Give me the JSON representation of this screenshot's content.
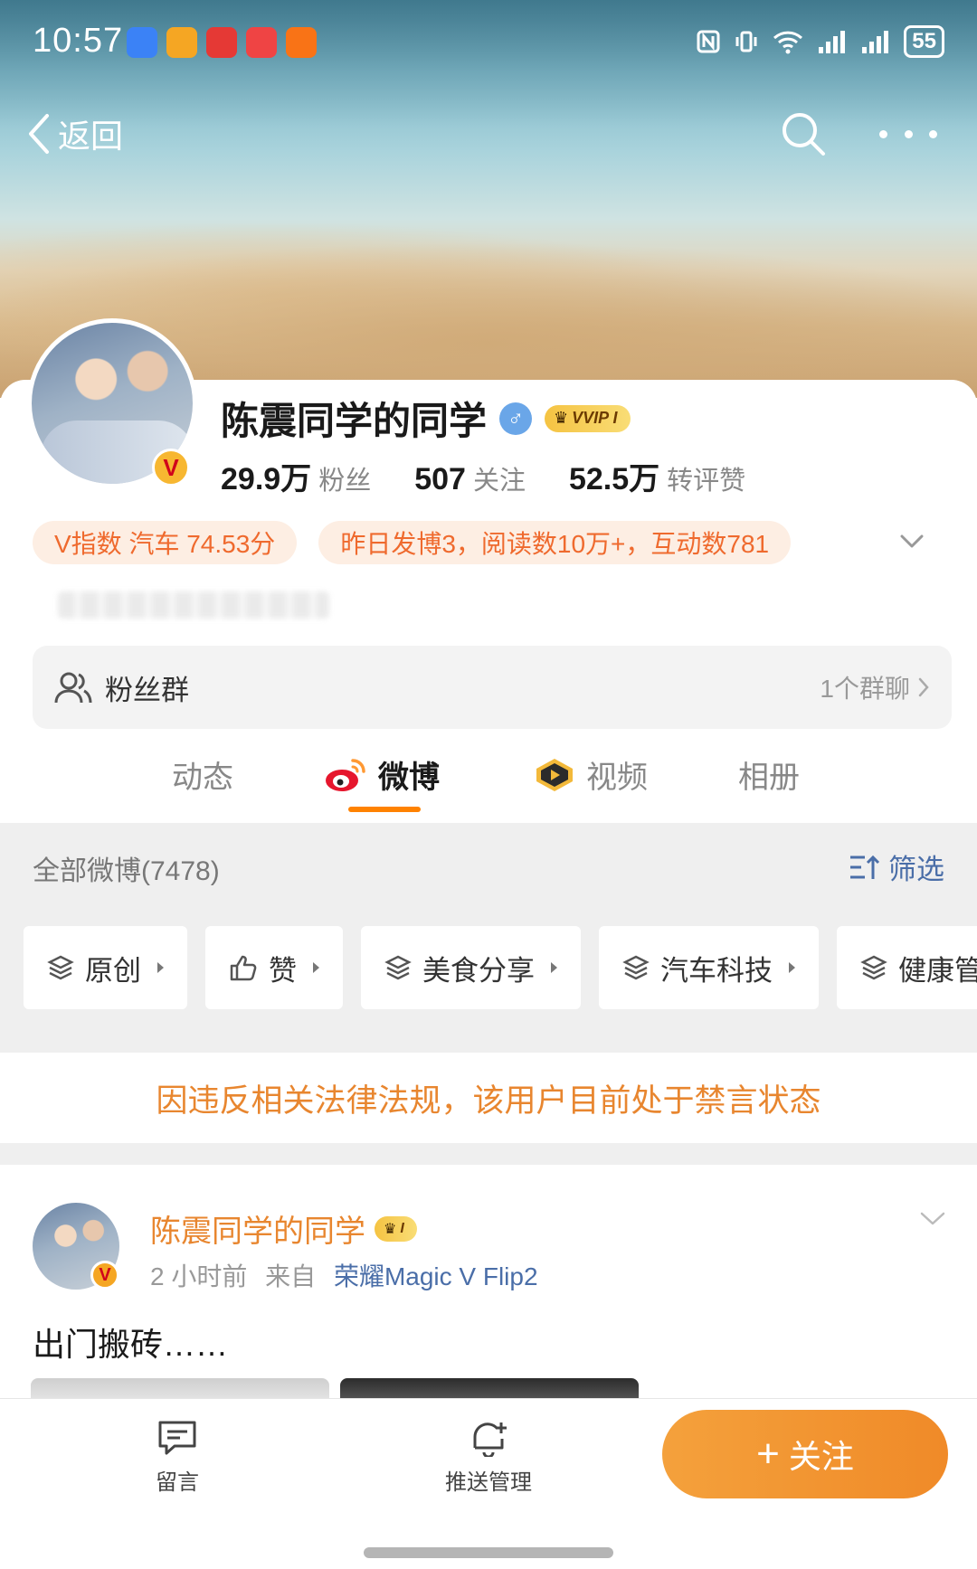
{
  "status_bar": {
    "time": "10:57",
    "battery": "55"
  },
  "nav": {
    "back_label": "返回"
  },
  "profile": {
    "name": "陈震同学的同学",
    "gender_symbol": "♂",
    "vip_label": "VVIP I",
    "v_badge": "V",
    "stats": [
      {
        "value": "29.9万",
        "label": "粉丝"
      },
      {
        "value": "507",
        "label": "关注"
      },
      {
        "value": "52.5万",
        "label": "转评赞"
      }
    ],
    "tags": [
      "V指数 汽车 74.53分",
      "昨日发博3，阅读数10万+，互动数781"
    ],
    "fans_group": {
      "label": "粉丝群",
      "count": "1个群聊"
    }
  },
  "tabs": [
    {
      "label": "动态",
      "active": false
    },
    {
      "label": "微博",
      "active": true
    },
    {
      "label": "视频",
      "active": false
    },
    {
      "label": "相册",
      "active": false
    }
  ],
  "filter": {
    "all_label": "全部微博(7478)",
    "filter_label": "筛选",
    "chips": [
      "原创",
      "赞",
      "美食分享",
      "汽车科技",
      "健康管"
    ]
  },
  "ban_notice": "因违反相关法律法规，该用户目前处于禁言状态",
  "post": {
    "author": "陈震同学的同学",
    "vip_label": "I",
    "time": "2 小时前",
    "source_prefix": "来自",
    "device": "荣耀Magic V Flip2",
    "text": "出门搬砖……"
  },
  "bottom_bar": {
    "message_label": "留言",
    "push_label": "推送管理",
    "follow_label": "关注",
    "follow_plus": "+"
  },
  "colors": {
    "accent": "#ff8200",
    "link": "#4a6ea8",
    "notice": "#e8862f"
  }
}
